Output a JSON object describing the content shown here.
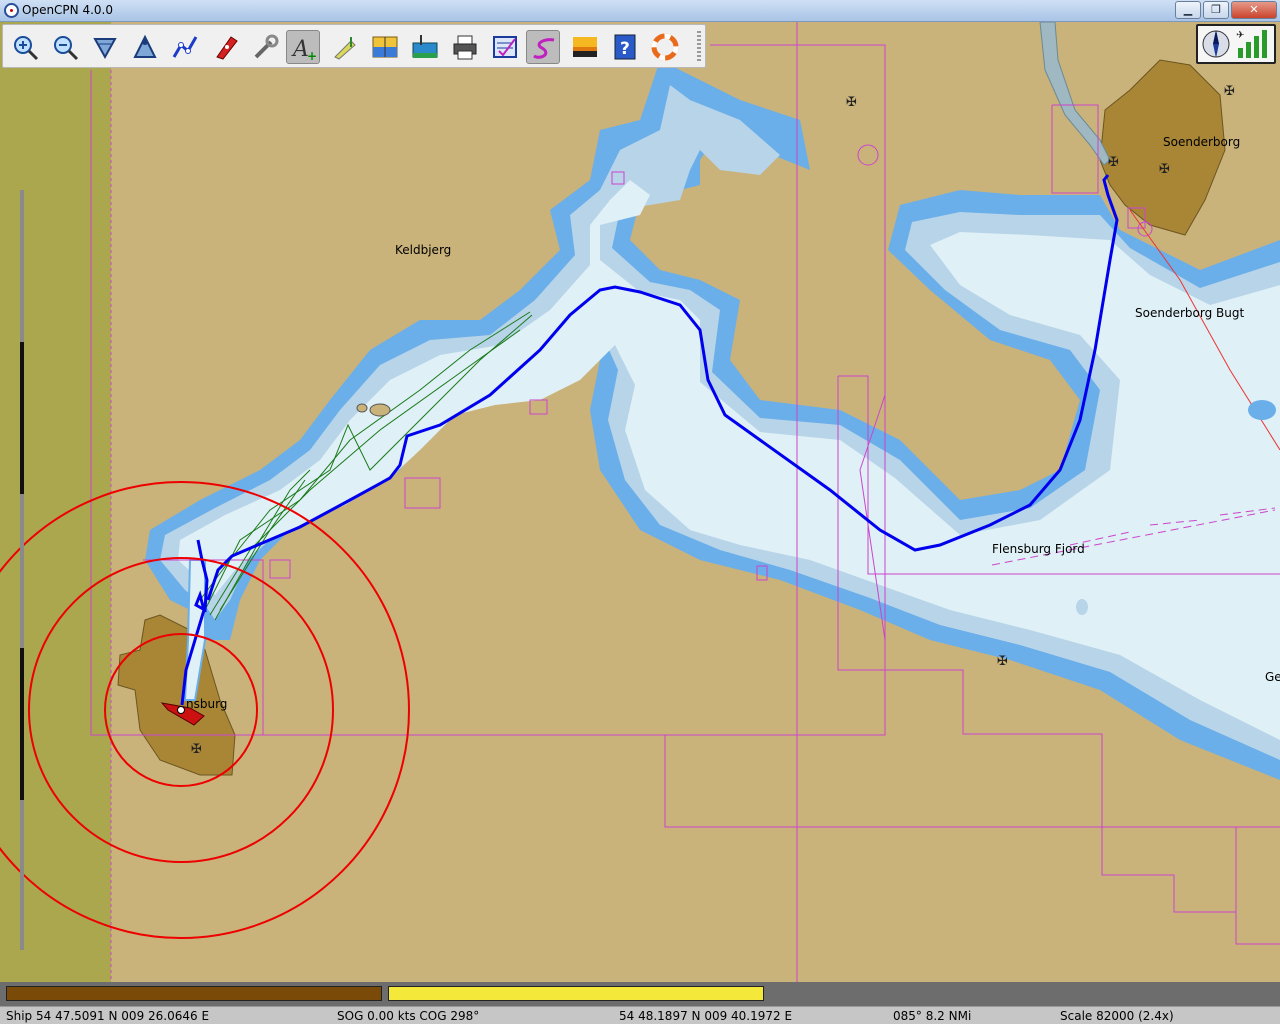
{
  "window": {
    "title": "OpenCPN 4.0.0",
    "controls": {
      "minimize": "▁",
      "maximize": "❐",
      "close": "✕"
    }
  },
  "toolbar": {
    "tools": [
      {
        "name": "zoom-in-icon",
        "active": false
      },
      {
        "name": "zoom-out-icon",
        "active": false
      },
      {
        "name": "scale-in-icon",
        "active": false
      },
      {
        "name": "scale-out-icon",
        "active": false
      },
      {
        "name": "route-icon",
        "active": false
      },
      {
        "name": "follow-ship-icon",
        "active": false
      },
      {
        "name": "settings-icon",
        "active": false
      },
      {
        "name": "text-icon",
        "active": true
      },
      {
        "name": "mark-icon",
        "active": false
      },
      {
        "name": "tide-icon",
        "active": false
      },
      {
        "name": "current-icon",
        "active": false
      },
      {
        "name": "print-icon",
        "active": false
      },
      {
        "name": "route-manager-icon",
        "active": false
      },
      {
        "name": "track-icon",
        "active": true
      },
      {
        "name": "color-scheme-icon",
        "active": false
      },
      {
        "name": "help-icon",
        "active": false
      },
      {
        "name": "mob-icon",
        "active": false
      }
    ]
  },
  "chart": {
    "labels": {
      "keldbjerg": "Keldbjerg",
      "soenderborg": "Soenderborg",
      "soenderborg_bugt": "Soenderborg Bugt",
      "flensburg_fjord": "Flensburg Fjord",
      "flensburg": "nsburg",
      "ge": "Ge"
    },
    "colors": {
      "land": "#c9b37a",
      "deep_water": "#dff0f6",
      "shallow": "#b7d4e8",
      "coast": "#6aaeea",
      "track": "#0000ee",
      "range_ring": "#ee0000",
      "chart_bounds": "#cc44cc",
      "town": "#a88636"
    }
  },
  "status": {
    "ship": "Ship 54 47.5091 N   009 26.0646 E",
    "sog_cog": "SOG 0.00 kts  COG 298°",
    "cursor": "54 48.1897 N   009 40.1972 E",
    "bearing": "085°  8.2 NMi",
    "scale": "Scale 82000 (2.4x)"
  }
}
